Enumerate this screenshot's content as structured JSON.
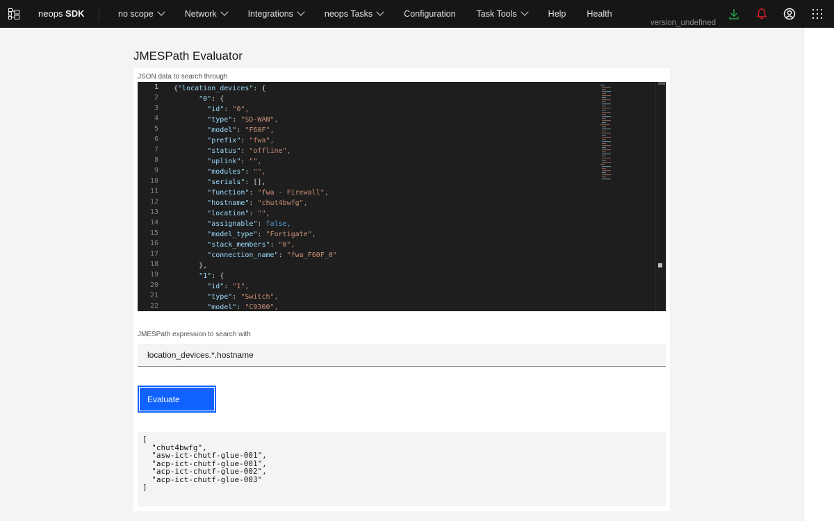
{
  "header": {
    "brand_prefix": "neops",
    "brand_name": "SDK",
    "nav": [
      {
        "label": "no scope",
        "dropdown": true
      },
      {
        "label": "Network",
        "dropdown": true
      },
      {
        "label": "Integrations",
        "dropdown": true
      },
      {
        "label": "neops Tasks",
        "dropdown": true
      },
      {
        "label": "Configuration",
        "dropdown": false
      },
      {
        "label": "Task Tools",
        "dropdown": true
      },
      {
        "label": "Help",
        "dropdown": false
      },
      {
        "label": "Health",
        "dropdown": false
      }
    ],
    "icons": [
      "download-icon",
      "notification-icon",
      "user-avatar-icon",
      "app-switcher-icon"
    ],
    "version": "version_undefined",
    "colors": {
      "background": "#161616",
      "download": "#24a148",
      "notification": "#da1e28"
    }
  },
  "page": {
    "title": "JMESPath Evaluator",
    "json_label": "JSON data to search through",
    "expression_label": "JMESPath expression to search with",
    "expression_value": "location_devices.*.hostname",
    "evaluate_label": "Evaluate",
    "result_text": "[\n  \"chut4bwfg\",\n  \"asw-ict-chutf-glue-001\",\n  \"acp-ict-chutf-glue-001\",\n  \"acp-ict-chutf-glue-002\",\n  \"acp-ict-chutf-glue-003\"\n]"
  },
  "editor": {
    "lines": [
      {
        "n": "1",
        "indent": "",
        "key": "location_devices",
        "val": "{",
        "type": "p",
        "sep": ": "
      },
      {
        "n": "2",
        "indent": "      ",
        "key": "0",
        "val": "{",
        "type": "p",
        "sep": ": "
      },
      {
        "n": "3",
        "indent": "        ",
        "key": "id",
        "val": "\"0\",",
        "type": "s",
        "sep": ": "
      },
      {
        "n": "4",
        "indent": "        ",
        "key": "type",
        "val": "\"SD-WAN\",",
        "type": "s",
        "sep": ": "
      },
      {
        "n": "5",
        "indent": "        ",
        "key": "model",
        "val": "\"F60F\",",
        "type": "s",
        "sep": ": "
      },
      {
        "n": "6",
        "indent": "        ",
        "key": "prefix",
        "val": "\"fwa\",",
        "type": "s",
        "sep": ": "
      },
      {
        "n": "7",
        "indent": "        ",
        "key": "status",
        "val": "\"offline\",",
        "type": "s",
        "sep": ": "
      },
      {
        "n": "8",
        "indent": "        ",
        "key": "uplink",
        "val": "\"\",",
        "type": "s",
        "sep": ": "
      },
      {
        "n": "9",
        "indent": "        ",
        "key": "modules",
        "val": "\"\",",
        "type": "s",
        "sep": ": "
      },
      {
        "n": "10",
        "indent": "        ",
        "key": "serials",
        "val": "[],",
        "type": "p",
        "sep": ": "
      },
      {
        "n": "11",
        "indent": "        ",
        "key": "function",
        "val": "\"fwa - Firewall\",",
        "type": "s",
        "sep": ": "
      },
      {
        "n": "12",
        "indent": "        ",
        "key": "hostname",
        "val": "\"chut4bwfg\",",
        "type": "s",
        "sep": ": "
      },
      {
        "n": "13",
        "indent": "        ",
        "key": "location",
        "val": "\"\",",
        "type": "s",
        "sep": ": "
      },
      {
        "n": "14",
        "indent": "        ",
        "key": "assignable",
        "val": "false,",
        "type": "b",
        "sep": ": "
      },
      {
        "n": "15",
        "indent": "        ",
        "key": "model_type",
        "val": "\"Fortigate\",",
        "type": "s",
        "sep": ": "
      },
      {
        "n": "16",
        "indent": "        ",
        "key": "stack_members",
        "val": "\"0\",",
        "type": "s",
        "sep": ": "
      },
      {
        "n": "17",
        "indent": "        ",
        "key": "connection_name",
        "val": "\"fwa_F60F_0\"",
        "type": "s",
        "sep": ": "
      },
      {
        "n": "18",
        "indent": "      ",
        "key": "",
        "val": "},",
        "type": "p",
        "sep": ""
      },
      {
        "n": "19",
        "indent": "      ",
        "key": "1",
        "val": "{",
        "type": "p",
        "sep": ": "
      },
      {
        "n": "20",
        "indent": "        ",
        "key": "id",
        "val": "\"1\",",
        "type": "s",
        "sep": ": "
      },
      {
        "n": "21",
        "indent": "        ",
        "key": "type",
        "val": "\"Switch\",",
        "type": "s",
        "sep": ": "
      },
      {
        "n": "22",
        "indent": "        ",
        "key": "model",
        "val": "\"C9300\",",
        "type": "s",
        "sep": ": "
      }
    ]
  }
}
